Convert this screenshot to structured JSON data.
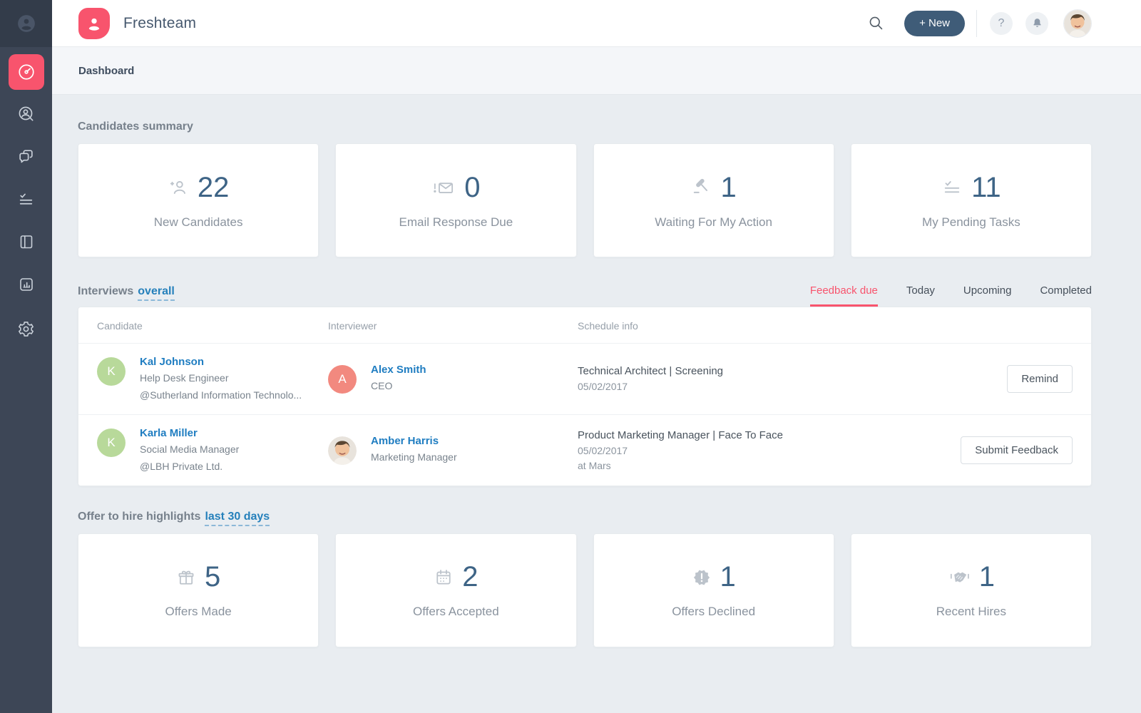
{
  "brand": {
    "name": "Freshteam"
  },
  "topbar": {
    "new_button": "+ New",
    "help_label": "?"
  },
  "breadcrumb": {
    "label": "Dashboard"
  },
  "sidebar": {
    "items": [
      "dashboard",
      "candidates",
      "conversations",
      "tasks",
      "job-boards",
      "reports",
      "settings"
    ]
  },
  "candidates_summary": {
    "title": "Candidates summary",
    "cards": [
      {
        "icon": "add-user-icon",
        "value": "22",
        "label": "New Candidates"
      },
      {
        "icon": "email-alert-icon",
        "value": "0",
        "label": "Email Response Due"
      },
      {
        "icon": "gavel-icon",
        "value": "1",
        "label": "Waiting For My Action"
      },
      {
        "icon": "checklist-icon",
        "value": "11",
        "label": "My Pending Tasks"
      }
    ]
  },
  "interviews": {
    "title": "Interviews",
    "filter": "overall",
    "tabs": [
      {
        "label": "Feedback due",
        "active": true
      },
      {
        "label": "Today",
        "active": false
      },
      {
        "label": "Upcoming",
        "active": false
      },
      {
        "label": "Completed",
        "active": false
      }
    ],
    "columns": [
      "Candidate",
      "Interviewer",
      "Schedule info"
    ],
    "rows": [
      {
        "candidate": {
          "initial": "K",
          "name": "Kal Johnson",
          "role": "Help Desk Engineer",
          "company": "@Sutherland Information Technolo...",
          "avatar_color": "#b8d99a"
        },
        "interviewer": {
          "initial": "A",
          "name": "Alex Smith",
          "role": "CEO",
          "avatar_color": "#f2897f",
          "avatar_type": "initial"
        },
        "schedule": {
          "position": "Technical Architect | Screening",
          "date": "05/02/2017",
          "location": ""
        },
        "action": "Remind"
      },
      {
        "candidate": {
          "initial": "K",
          "name": "Karla Miller",
          "role": "Social Media Manager",
          "company": "@LBH Private Ltd.",
          "avatar_color": "#b8d99a"
        },
        "interviewer": {
          "initial": "",
          "name": "Amber Harris",
          "role": "Marketing Manager",
          "avatar_type": "photo"
        },
        "schedule": {
          "position": "Product Marketing Manager | Face To Face",
          "date": "05/02/2017",
          "location": "at Mars"
        },
        "action": "Submit Feedback"
      }
    ]
  },
  "offers": {
    "title": "Offer to hire highlights",
    "filter": "last 30 days",
    "cards": [
      {
        "icon": "gift-icon",
        "value": "5",
        "label": "Offers Made"
      },
      {
        "icon": "calendar-icon",
        "value": "2",
        "label": "Offers Accepted"
      },
      {
        "icon": "badge-alert-icon",
        "value": "1",
        "label": "Offers Declined"
      },
      {
        "icon": "handshake-icon",
        "value": "1",
        "label": "Recent Hires"
      }
    ]
  },
  "colors": {
    "accent_red": "#f8546d",
    "number_blue": "#3e6486",
    "link_blue": "#1f7dc1",
    "sidebar_bg": "#3d4656",
    "new_button_bg": "#3f5c78",
    "avatar_green": "#b8d99a",
    "avatar_salmon": "#f2897f"
  }
}
